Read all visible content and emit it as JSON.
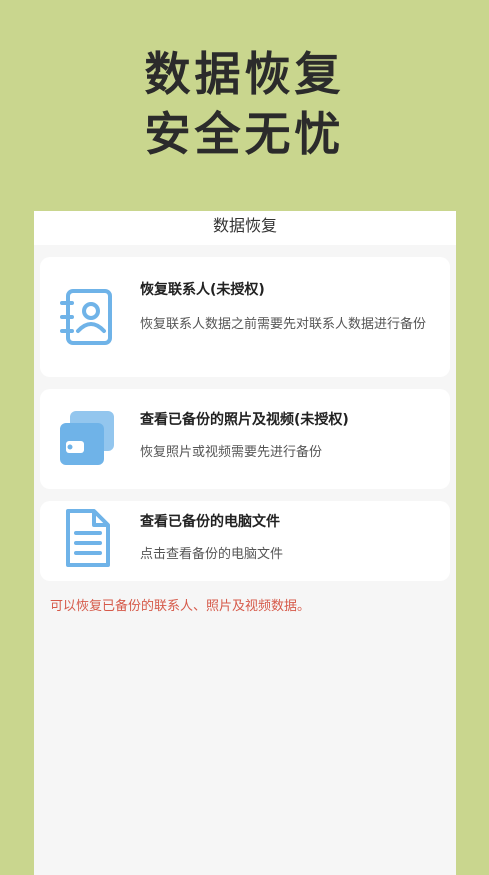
{
  "hero": {
    "line1": "数据恢复",
    "line2": "安全无忧"
  },
  "screen": {
    "title": "数据恢复",
    "cards": [
      {
        "icon": "contacts-book-icon",
        "title": "恢复联系人(未授权)",
        "desc": "恢复联系人数据之前需要先对联系人数据进行备份"
      },
      {
        "icon": "photos-icon",
        "title": "查看已备份的照片及视频(未授权)",
        "desc": "恢复照片或视频需要先进行备份"
      },
      {
        "icon": "document-icon",
        "title": "查看已备份的电脑文件",
        "desc": "点击查看备份的电脑文件"
      }
    ],
    "note": "可以恢复已备份的联系人、照片及视频数据。"
  },
  "colors": {
    "background": "#c9d68e",
    "icon": "#6fb3e8",
    "note": "#d65a4a"
  }
}
